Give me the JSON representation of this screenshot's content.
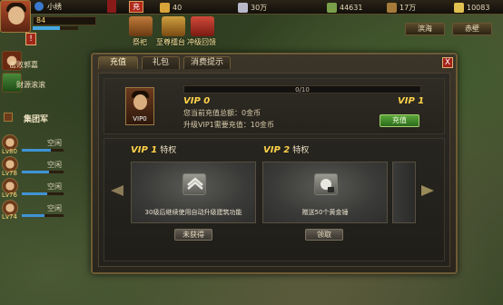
{
  "player": {
    "name": "小绣",
    "level": "84"
  },
  "top_buttons": {
    "charge": "充"
  },
  "resources": [
    {
      "name": "food",
      "value": "40",
      "color": "#d9a43a"
    },
    {
      "name": "silver",
      "value": "30万",
      "color": "#b8b8c8"
    },
    {
      "name": "troops",
      "value": "44631",
      "color": "#7aa04a"
    },
    {
      "name": "wood",
      "value": "17万",
      "color": "#a67a3a"
    },
    {
      "name": "gold",
      "value": "10083",
      "color": "#e0c050"
    }
  ],
  "festival": [
    {
      "label": "祭祀"
    },
    {
      "label": "至尊擂台"
    },
    {
      "label": "冲级回馈"
    }
  ],
  "right_buttons": {
    "left_label": "滨海",
    "right_label": "赤壁"
  },
  "sidebar": [
    {
      "label": "击败郭嘉"
    },
    {
      "label": "财源滚滚"
    }
  ],
  "army": {
    "title": "集团军",
    "rows": [
      {
        "lv": "Lv80",
        "state": "空闲"
      },
      {
        "lv": "Lv78",
        "state": "空闲"
      },
      {
        "lv": "Lv76",
        "state": "空闲"
      },
      {
        "lv": "Lv74",
        "state": "空闲"
      }
    ]
  },
  "dialog": {
    "tabs": [
      "充值",
      "礼包",
      "消费提示"
    ],
    "close_label": "X",
    "vip_badge": "VIP0",
    "current_vip": "VIP 0",
    "next_vip": "VIP 1",
    "progress": "0/10",
    "line1": "您当前充值总额：0金币",
    "line2": "升级VIP1需要充值：10金币",
    "recharge_label": "充值",
    "privileges": [
      {
        "vip": "VIP 1",
        "suffix": "特权",
        "desc": "30级后继续使用自动升级建筑功能",
        "button": "未获得"
      },
      {
        "vip": "VIP 2",
        "suffix": "特权",
        "desc": "赠送50个黄金锤",
        "button": "领取"
      }
    ]
  }
}
